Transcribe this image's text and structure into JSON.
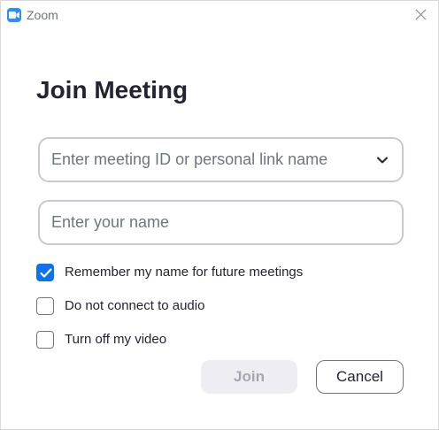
{
  "window": {
    "app_name": "Zoom",
    "icon": "zoom-camera-icon",
    "close_icon": "close-icon"
  },
  "title": "Join Meeting",
  "meeting_field": {
    "value": "",
    "placeholder": "Enter meeting ID or personal link name",
    "dropdown_icon": "chevron-down-icon"
  },
  "name_field": {
    "value": "",
    "placeholder": "Enter your name"
  },
  "options": [
    {
      "label": "Remember my name for future meetings",
      "checked": true
    },
    {
      "label": "Do not connect to audio",
      "checked": false
    },
    {
      "label": "Turn off my video",
      "checked": false
    }
  ],
  "buttons": {
    "join": "Join",
    "join_enabled": false,
    "cancel": "Cancel"
  },
  "colors": {
    "accent": "#0e72ed",
    "zoom_brand": "#2d8cff",
    "disabled_button_bg": "#ededf2",
    "disabled_button_text": "#a6a6b2"
  }
}
